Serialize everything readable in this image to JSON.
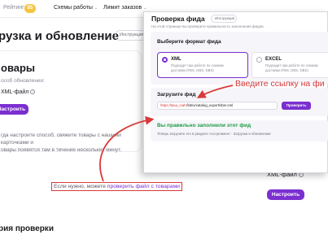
{
  "topbar": {
    "rating_label": "Рейтинг:",
    "rating_value": "85",
    "nav": [
      {
        "label": "Схемы работы",
        "chevron": "⌄"
      },
      {
        "label": "Лимит заказов",
        "chevron": "⌄"
      }
    ]
  },
  "background": {
    "page_title": "рузка и обновление",
    "instructions_button": "Инструкция",
    "products_card": {
      "title": "овары",
      "hint": "особ обновления:",
      "format_label": "XML-файл",
      "info_glyph": "i",
      "configure_button": "Настроить",
      "note": "гда настроите способ, свяжите товары с нашими карточками и\nовары появятся там в течение нескольких минут."
    },
    "check_line": {
      "prefix": "Если нужно, можете ",
      "link": "проверить файл с товарами"
    },
    "history_title": "рия проверки",
    "right_card": {
      "format_label": "XML-файл",
      "info_glyph": "i",
      "configure_button": "Настроить"
    }
  },
  "modal": {
    "title": "Проверка фида",
    "instructions_badge": "Инструкция",
    "subtitle": "На этой странице вы проверите правильность заполнения фидов.",
    "format_section": {
      "label": "Выберите формат фида",
      "options": [
        {
          "name": "XML",
          "desc": "Подходит при работе по схемам доставки (FBS, DBS, DBS)",
          "selected": true
        },
        {
          "name": "EXCEL",
          "desc": "Подходит при работе по схемам доставки (FBS, DBS, DBS)",
          "selected": false
        }
      ]
    },
    "upload_section": {
      "label": "Загрузите фид",
      "url_highlight": "https://ваш_сайт",
      "url_rest": "/bitrix/catalog_export/sber.xml",
      "check_button": "Проверить"
    },
    "result": {
      "title": "Вы правильно заполнили этот фид",
      "desc": "Теперь загрузите его в разделе Ассортимент - Загрузка и обновление"
    }
  },
  "annotation": {
    "callout": "Введите ссылку на фи",
    "arrow_color": "#d93a3a"
  }
}
